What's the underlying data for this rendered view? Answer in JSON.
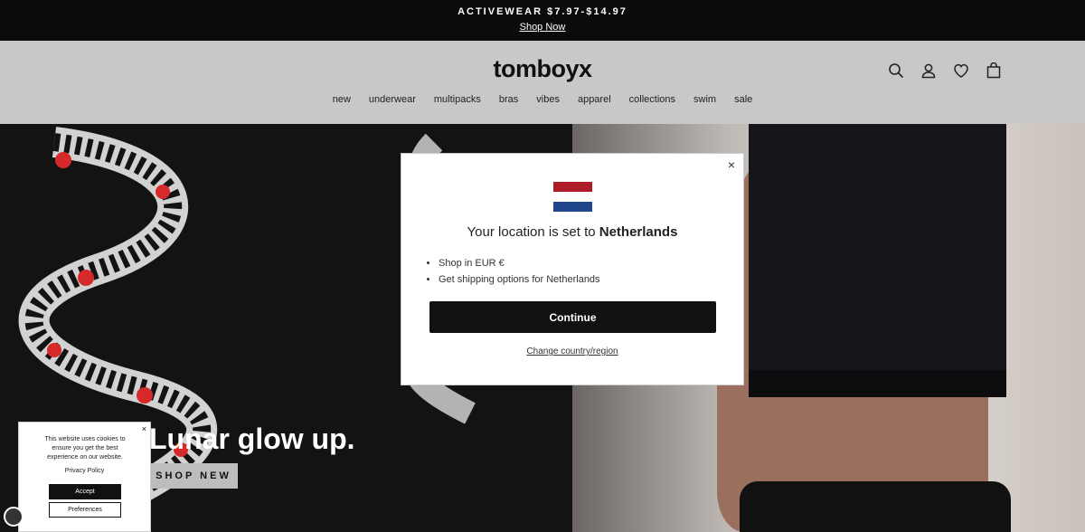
{
  "announcement": {
    "promo": "ACTIVEWEAR $7.97-$14.97",
    "link": "Shop Now"
  },
  "header": {
    "logo": "tomboyx",
    "nav": [
      "new",
      "underwear",
      "multipacks",
      "bras",
      "vibes",
      "apparel",
      "collections",
      "swim",
      "sale"
    ],
    "icons": [
      "search-icon",
      "account-icon",
      "heart-icon",
      "bag-icon"
    ]
  },
  "hero": {
    "title": "Lunar glow up.",
    "cta": "SHOP NEW"
  },
  "location_modal": {
    "message_prefix": "Your location is set to ",
    "country": "Netherlands",
    "bullets": [
      "Shop in EUR €",
      "Get shipping options for Netherlands"
    ],
    "continue_label": "Continue",
    "change_label": "Change country/region",
    "close": "×",
    "flag_colors": [
      "#ae1c28",
      "#ffffff",
      "#21468b"
    ]
  },
  "cookie_banner": {
    "text": "This website uses cookies to ensure you get the best experience on our website.",
    "privacy_label": "Privacy Policy",
    "accept_label": "Accept",
    "preferences_label": "Preferences",
    "close": "×"
  }
}
